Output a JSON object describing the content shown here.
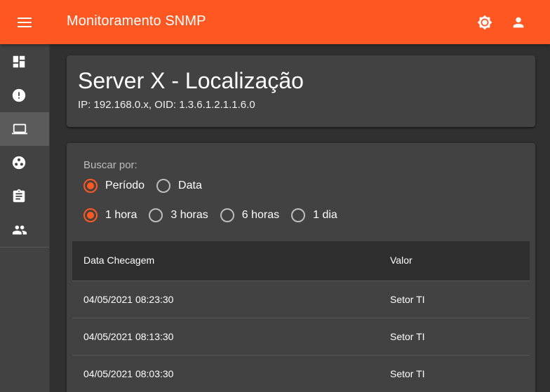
{
  "app": {
    "title": "Monitoramento SNMP"
  },
  "colors": {
    "accent": "#ff5722",
    "background": "#303030",
    "card": "#424242",
    "sidebar": "#424242"
  },
  "toolbar": {
    "menu_icon": "menu-icon",
    "theme_icon": "brightness-icon",
    "account_icon": "account-icon"
  },
  "sidebar": {
    "items": [
      {
        "icon": "dashboard-icon",
        "active": false
      },
      {
        "icon": "alert-icon",
        "active": false
      },
      {
        "icon": "laptop-icon",
        "active": true
      },
      {
        "icon": "hub-icon",
        "active": false
      },
      {
        "icon": "assignment-icon",
        "active": false
      },
      {
        "icon": "people-icon",
        "active": false
      }
    ]
  },
  "header": {
    "title": "Server X - Localização",
    "subtitle": "IP: 192.168.0.x, OID: 1.3.6.1.2.1.1.6.0"
  },
  "search": {
    "label": "Buscar por:",
    "mode_options": [
      {
        "label": "Período",
        "checked": true
      },
      {
        "label": "Data",
        "checked": false
      }
    ],
    "range_options": [
      {
        "label": "1 hora",
        "checked": true
      },
      {
        "label": "3 horas",
        "checked": false
      },
      {
        "label": "6 horas",
        "checked": false
      },
      {
        "label": "1 dia",
        "checked": false
      }
    ]
  },
  "table": {
    "columns": [
      "Data Checagem",
      "Valor"
    ],
    "rows": [
      [
        "04/05/2021 08:23:30",
        "Setor TI"
      ],
      [
        "04/05/2021 08:13:30",
        "Setor TI"
      ],
      [
        "04/05/2021 08:03:30",
        "Setor TI"
      ]
    ]
  }
}
